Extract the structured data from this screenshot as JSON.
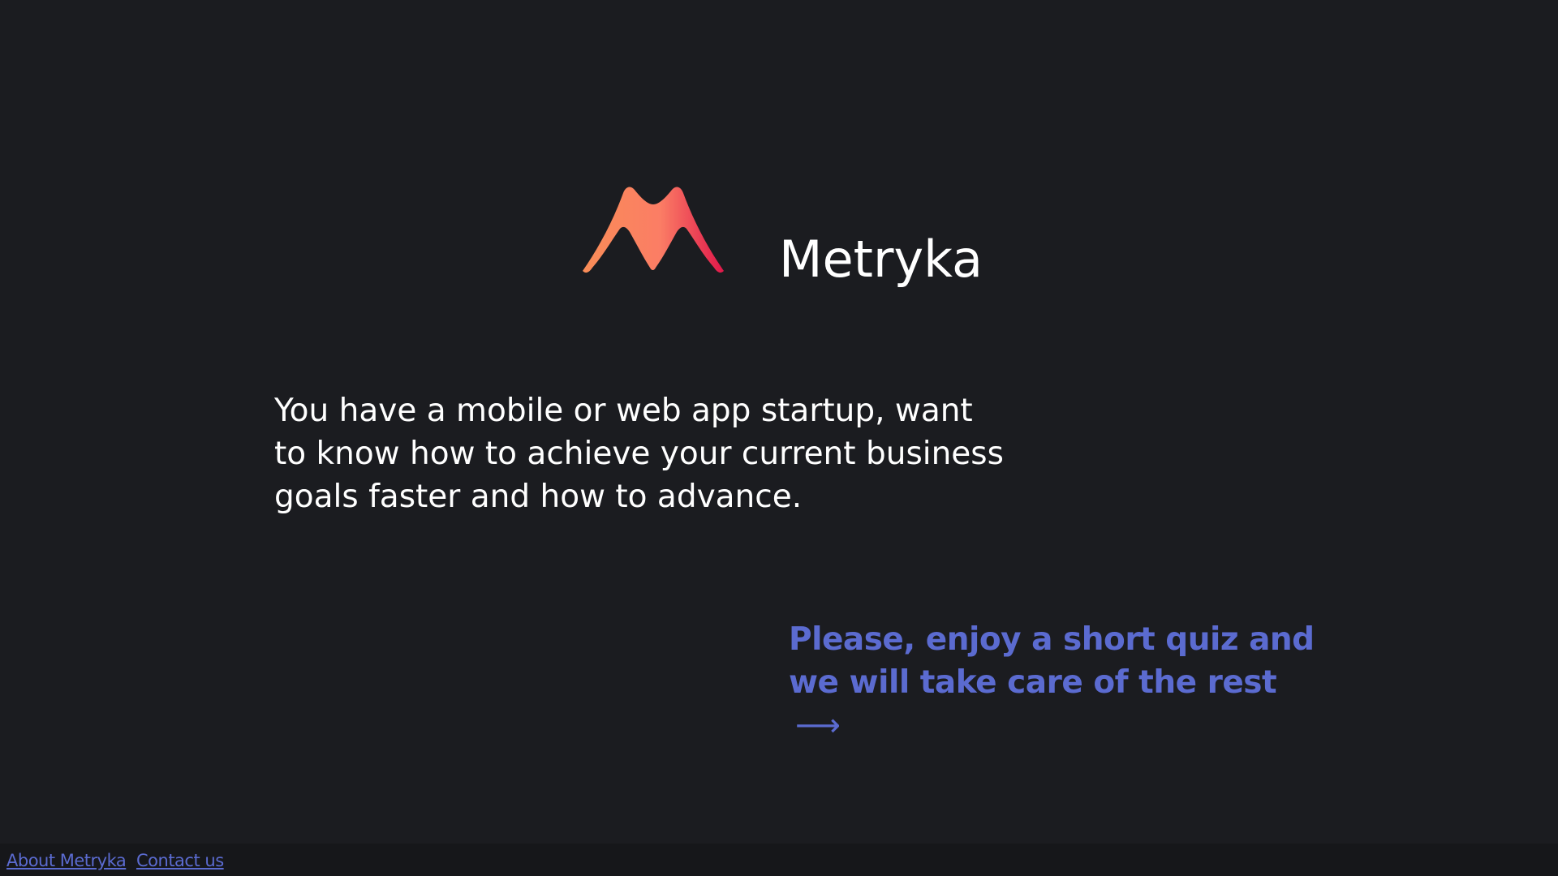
{
  "brand": {
    "name": "Metryka",
    "logo_icon": "metryka-m-logo-icon",
    "logo_gradient": [
      "#f98d57",
      "#fb7d65",
      "#e0184a"
    ]
  },
  "intro": {
    "text": "You have a mobile or web app startup, want to know how to achieve your current business goals faster and how to advance."
  },
  "cta": {
    "text": "Please, enjoy a short quiz and we will take care of the rest",
    "arrow": "⟶",
    "color": "#5b6bd0"
  },
  "footer": {
    "about_label": "About Metryka",
    "contact_label": "Contact us",
    "link_color": "#5b6bd0"
  },
  "colors": {
    "background": "#1b1c20",
    "footer_background": "#16171a",
    "text": "#ffffff"
  }
}
